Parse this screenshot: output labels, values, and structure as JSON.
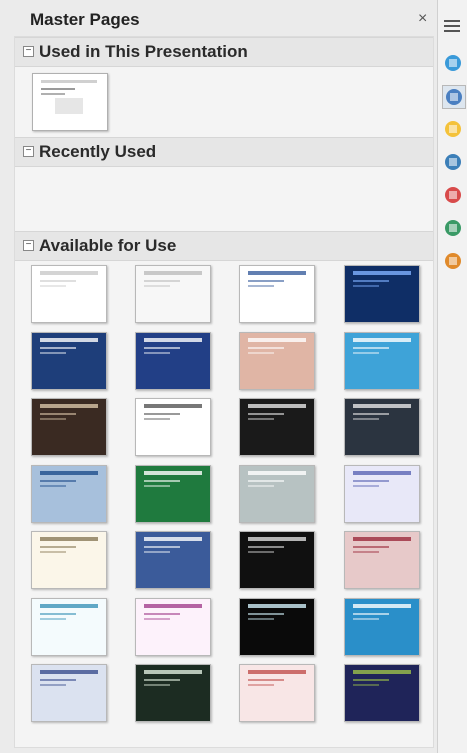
{
  "panel": {
    "title": "Master Pages",
    "close_label": "×"
  },
  "sections": {
    "used": {
      "label": "Used in This Presentation",
      "toggle": "−"
    },
    "recent": {
      "label": "Recently Used",
      "toggle": "−"
    },
    "available": {
      "label": "Available for Use",
      "toggle": "−"
    }
  },
  "colors": {
    "panel_bg": "#ebebeb",
    "header_bg": "#e6e6e6"
  },
  "used_masters": [
    {
      "theme": "plain-white"
    }
  ],
  "available_masters": [
    {
      "theme": "plain-white",
      "bg": "#ffffff",
      "accent": "#c9c9c9"
    },
    {
      "theme": "white-swirl",
      "bg": "#f7f7f7",
      "accent": "#bcbcbc"
    },
    {
      "theme": "white-blue-frame",
      "bg": "#ffffff",
      "accent": "#3b5f9e"
    },
    {
      "theme": "dark-blue-glow",
      "bg": "#0f2e66",
      "accent": "#7fb0ff"
    },
    {
      "theme": "blue-gradient",
      "bg": "#1e3e7a",
      "accent": "#ffffff"
    },
    {
      "theme": "navy-dark",
      "bg": "#223f86",
      "accent": "#ffffff"
    },
    {
      "theme": "peach-gradient",
      "bg": "#e0b5a5",
      "accent": "#ffffff"
    },
    {
      "theme": "sky-wave",
      "bg": "#3ea3d8",
      "accent": "#ffffff"
    },
    {
      "theme": "brown-dark",
      "bg": "#3a2a22",
      "accent": "#d8c4a8"
    },
    {
      "theme": "floral-border-white",
      "bg": "#ffffff",
      "accent": "#555555"
    },
    {
      "theme": "black-swirl",
      "bg": "#1a1a1a",
      "accent": "#e6e6e6"
    },
    {
      "theme": "dark-slate",
      "bg": "#2b3440",
      "accent": "#e6e6e6"
    },
    {
      "theme": "blue-sky-bar",
      "bg": "#a7c0dc",
      "accent": "#1f4d8c"
    },
    {
      "theme": "green-fade",
      "bg": "#1f7a3e",
      "accent": "#ffffff"
    },
    {
      "theme": "grey-tiles",
      "bg": "#b7c2c2",
      "accent": "#ffffff"
    },
    {
      "theme": "lavender-glow",
      "bg": "#e8e8f8",
      "accent": "#5a64b4"
    },
    {
      "theme": "cream-lined",
      "bg": "#fbf6e9",
      "accent": "#8a7b57"
    },
    {
      "theme": "blue-texture",
      "bg": "#3b5b9a",
      "accent": "#ffffff"
    },
    {
      "theme": "black-lace",
      "bg": "#101010",
      "accent": "#dddddd"
    },
    {
      "theme": "rose-diagonal",
      "bg": "#e7c9c9",
      "accent": "#9c2b3c"
    },
    {
      "theme": "aqua-lines",
      "bg": "#f4fbfd",
      "accent": "#3b94b8"
    },
    {
      "theme": "pink-sparkle",
      "bg": "#fdf2fb",
      "accent": "#a33f8d"
    },
    {
      "theme": "black-cyan-frame",
      "bg": "#0a0a0a",
      "accent": "#cfeef7"
    },
    {
      "theme": "ocean-waves",
      "bg": "#2a8fc9",
      "accent": "#ffffff"
    },
    {
      "theme": "pale-blue-frame",
      "bg": "#dbe2f0",
      "accent": "#3b4f8f"
    },
    {
      "theme": "leafy-dark",
      "bg": "#1c2c22",
      "accent": "#dfeede"
    },
    {
      "theme": "red-stripes",
      "bg": "#f8e6e6",
      "accent": "#c0504d"
    },
    {
      "theme": "midnight-navy",
      "bg": "#1f2459",
      "accent": "#9cc14a"
    }
  ],
  "sidebar": {
    "menu_icon": "hamburger-icon",
    "buttons": [
      {
        "name": "properties-icon",
        "color": "#3a9ad9",
        "active": false
      },
      {
        "name": "master-pages-icon",
        "color": "#4a7fc1",
        "active": true
      },
      {
        "name": "star-icon",
        "color": "#f4c23a",
        "active": false
      },
      {
        "name": "slide-transition-icon",
        "color": "#3c7fb8",
        "active": false
      },
      {
        "name": "animation-icon",
        "color": "#d84b4b",
        "active": false
      },
      {
        "name": "gallery-icon",
        "color": "#3a9a66",
        "active": false
      },
      {
        "name": "navigator-icon",
        "color": "#e08a2b",
        "active": false
      }
    ]
  }
}
